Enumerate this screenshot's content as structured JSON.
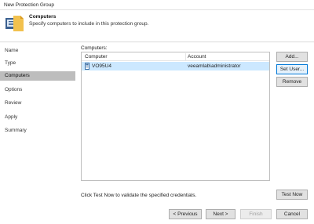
{
  "window": {
    "title": "New Protection Group"
  },
  "header": {
    "title": "Computers",
    "subtitle": "Specify computers to include in this protection group."
  },
  "sidebar": {
    "items": [
      {
        "label": "Name",
        "active": false
      },
      {
        "label": "Type",
        "active": false
      },
      {
        "label": "Computers",
        "active": true
      },
      {
        "label": "Options",
        "active": false
      },
      {
        "label": "Review",
        "active": false
      },
      {
        "label": "Apply",
        "active": false
      },
      {
        "label": "Summary",
        "active": false
      }
    ]
  },
  "computers": {
    "label": "Computers:",
    "columns": [
      "Computer",
      "Account"
    ],
    "rows": [
      {
        "computer": "VO95U4",
        "account": "veeamlab\\administrator",
        "icon": "computer-icon",
        "selected": true
      }
    ]
  },
  "side_buttons": {
    "add": "Add...",
    "set_user": "Set User...",
    "remove": "Remove"
  },
  "hint": "Click Test Now to validate the specified credentials.",
  "test_now": "Test Now",
  "nav": {
    "previous": "< Previous",
    "next": "Next >",
    "finish": "Finish",
    "cancel": "Cancel"
  },
  "colors": {
    "selection": "#cce8ff",
    "sidebar_active": "#bdbdbd",
    "focus_border": "#0078d7"
  }
}
